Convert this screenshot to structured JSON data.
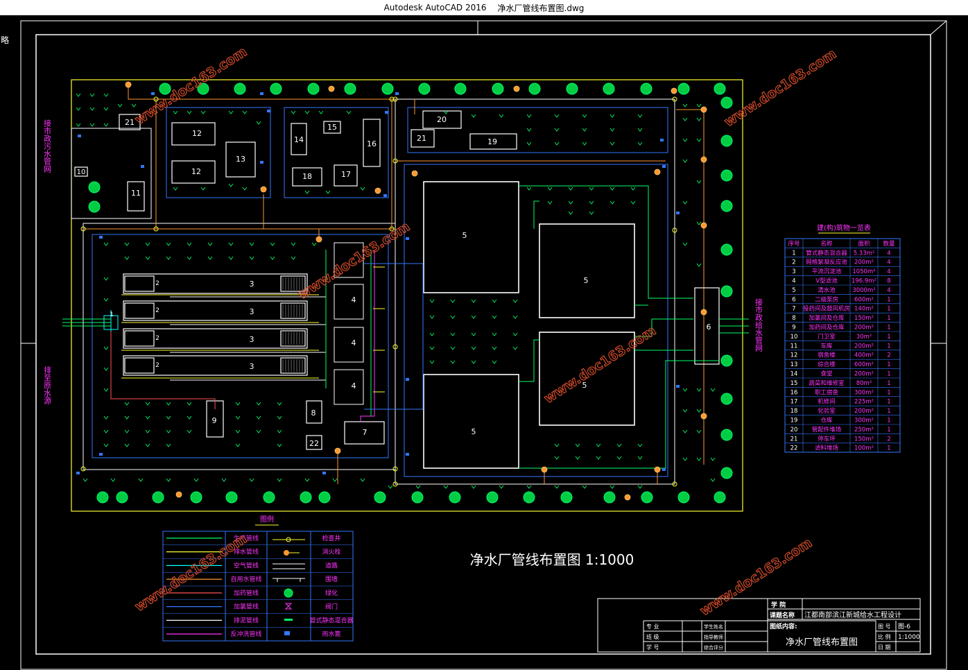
{
  "window": {
    "app_title": "Autodesk AutoCAD 2016",
    "file_name": "净水厂管线布置图.dwg",
    "corner_glyph": "略"
  },
  "drawing": {
    "main_title": "净水厂管线布置图 1:1000",
    "watermark": "www.doc163.com",
    "left_labels": {
      "top": "接市政污水管网",
      "bottom": "排至原水源"
    },
    "right_label": "接市政给水管网",
    "blocks": {
      "b21a": "21",
      "b10": "10",
      "b11": "11",
      "b12a": "12",
      "b12b": "12",
      "b13": "13",
      "b14": "14",
      "b15": "15",
      "b16": "16",
      "b17": "17",
      "b18": "18",
      "b20": "20",
      "b21b": "21",
      "b19": "19",
      "b5a": "5",
      "b5b": "5",
      "b5c": "5",
      "b5d": "5",
      "b6": "6",
      "b3a": "3",
      "b3b": "3",
      "b3c": "3",
      "b3d": "3",
      "b2a": "2",
      "b2b": "2",
      "b2c": "2",
      "b2d": "2",
      "b4a": "4",
      "b4b": "4",
      "b4c": "4",
      "b1": "1",
      "b9": "9",
      "b8": "8",
      "b22": "22",
      "b7": "7"
    }
  },
  "building_table": {
    "title": "建(构)筑物一览表",
    "headers": [
      "序号",
      "名称",
      "面积",
      "数量"
    ],
    "rows": [
      [
        "1",
        "管式静态混合器",
        "5.33m²",
        "4"
      ],
      [
        "2",
        "网格絮凝反应池",
        "200m²",
        "4"
      ],
      [
        "3",
        "平流沉淀池",
        "1050m²",
        "4"
      ],
      [
        "4",
        "V型滤池",
        "196.9m²",
        "8"
      ],
      [
        "5",
        "清水池",
        "3000m²",
        "4"
      ],
      [
        "6",
        "二级泵房",
        "600m²",
        "1"
      ],
      [
        "7",
        "投药间及鼓风机房",
        "140m²",
        "1"
      ],
      [
        "8",
        "加氯间及仓库",
        "150m²",
        "1"
      ],
      [
        "9",
        "加药间及仓库",
        "200m²",
        "1"
      ],
      [
        "10",
        "门卫室",
        "30m²",
        "1"
      ],
      [
        "11",
        "车库",
        "200m²",
        "1"
      ],
      [
        "12",
        "宿舍楼",
        "400m²",
        "2"
      ],
      [
        "13",
        "综合楼",
        "600m²",
        "1"
      ],
      [
        "14",
        "食堂",
        "200m²",
        "1"
      ],
      [
        "15",
        "蔬菜和维修室",
        "80m²",
        "1"
      ],
      [
        "16",
        "职工宿舍",
        "300m²",
        "1"
      ],
      [
        "17",
        "机修间",
        "225m²",
        "1"
      ],
      [
        "18",
        "化验室",
        "200m²",
        "1"
      ],
      [
        "19",
        "仓库",
        "300m²",
        "1"
      ],
      [
        "20",
        "管配件堆场",
        "250m²",
        "1"
      ],
      [
        "21",
        "停车坪",
        "150m²",
        "2"
      ],
      [
        "22",
        "滤料堆场",
        "100m²",
        "1"
      ]
    ]
  },
  "legend": {
    "title": "图例",
    "rows": [
      {
        "line_label": "生产管线",
        "symbol_label": "检查井",
        "color": "#00ff66"
      },
      {
        "line_label": "排水管线",
        "symbol_label": "消火栓",
        "color": "#ffff33"
      },
      {
        "line_label": "空气管线",
        "symbol_label": "道路",
        "color": "#00ffff"
      },
      {
        "line_label": "自用水管线",
        "symbol_label": "围墙",
        "color": "#ff9933"
      },
      {
        "line_label": "加药管线",
        "symbol_label": "绿化",
        "color": "#ff5555"
      },
      {
        "line_label": "加氯管线",
        "symbol_label": "阀门",
        "color": "#3377ff"
      },
      {
        "line_label": "排泥管线",
        "symbol_label": "管式静态混合器",
        "color": "#ffffff"
      },
      {
        "line_label": "反冲洗管线",
        "symbol_label": "雨水篦",
        "color": "#ff33ff"
      }
    ]
  },
  "title_block": {
    "school": "学 院",
    "project_label": "课题名称",
    "project_value": "江都南部滨江新城给水工程设计",
    "content_label": "图纸内容:",
    "content_value": "净水厂管线布置图",
    "major_label": "专 业",
    "class_label": "班 级",
    "id_label": "学 号",
    "student_label": "学生姓名",
    "advisor_label": "指导教师",
    "grade_label": "综合评分",
    "sheet_label": "图 号",
    "sheet_value": "图-6",
    "scale_label": "比 例",
    "scale_value": "1:1000",
    "date_label": "日 期"
  }
}
